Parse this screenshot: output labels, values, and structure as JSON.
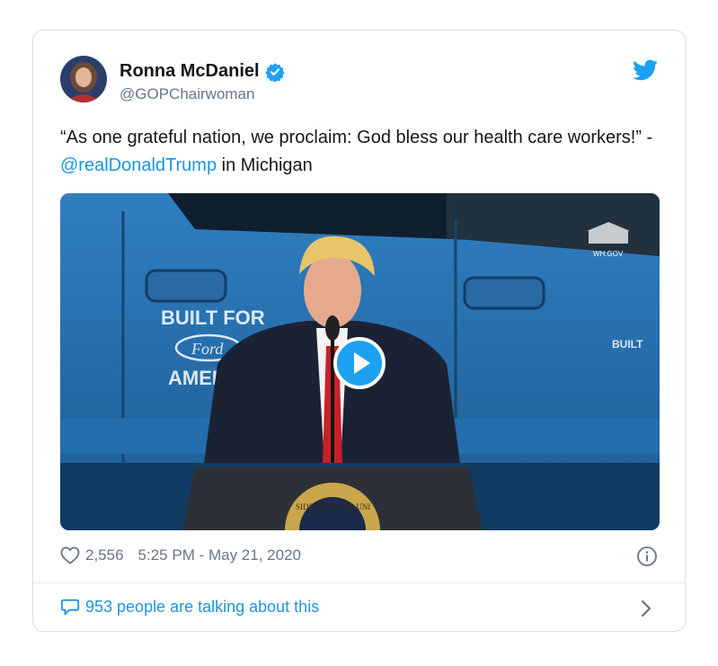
{
  "tweet": {
    "author_name": "Ronna McDaniel",
    "author_handle": "@GOPChairwoman",
    "text_before": "“As one grateful nation, we proclaim: God bless our health care workers!” - ",
    "mention": "@realDonaldTrump",
    "text_after": " in Michigan",
    "likes": "2,556",
    "timestamp": "5:25 PM - May 21, 2020",
    "talking": "953 people are talking about this"
  },
  "media": {
    "watermark": "WH.GOV",
    "truck_text_line1": "BUILT FOR",
    "truck_text_logo": "Ford",
    "truck_text_line2": "AMER",
    "truck_text_right": "BUILT",
    "seal_text": "SIDENT OF THE UNI"
  },
  "icons": {
    "verified": "verified-badge-icon",
    "brand": "twitter-bird-icon",
    "like": "heart-icon",
    "info": "info-icon",
    "reply": "speech-bubble-icon",
    "chevron": "chevron-right-icon",
    "play": "play-icon"
  },
  "colors": {
    "accent": "#1b95e0",
    "text": "#14171a",
    "muted": "#657786"
  }
}
